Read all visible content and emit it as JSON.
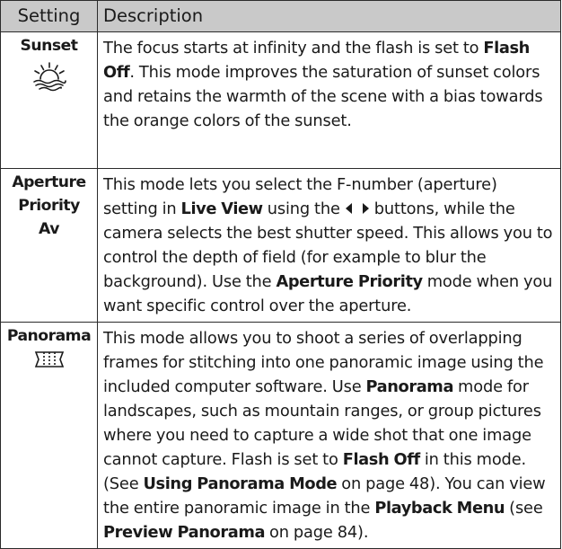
{
  "table": {
    "headers": {
      "setting": "Setting",
      "description": "Description"
    },
    "rows": {
      "sunset": {
        "name": "Sunset",
        "icon": "sunset-icon",
        "desc": {
          "t1": "The focus starts at infinity and the flash is set to ",
          "b1": "Flash Off",
          "t2": ". This mode improves the saturation of sunset colors and retains the warmth of the scene with a bias towards the orange colors of the sunset."
        }
      },
      "aperture": {
        "name_line1": "Aperture",
        "name_line2": "Priority",
        "name_line3": "Av",
        "desc": {
          "t1": "This mode lets you select the F-number (aperture) setting in ",
          "b1": "Live View",
          "t2": " using the",
          "arrows_icon": "left-right-arrows-icon",
          "t3": "buttons, while the camera selects the best shutter speed. This allows you to control the depth of field (for example to blur the background). Use the ",
          "b2": "Aperture Priority",
          "t4": " mode when you want specific control over the aperture."
        }
      },
      "panorama": {
        "name": "Panorama",
        "icon": "panorama-icon",
        "desc": {
          "t1": "This mode allows you to shoot a series of overlapping frames for stitching into one panoramic image using the included computer software. Use ",
          "b1": "Panorama",
          "t2": " mode for landscapes, such as mountain ranges, or group pictures where you need to capture a wide shot that one image cannot capture. Flash is set to ",
          "b2": "Flash Off",
          "t3": " in this mode. (See ",
          "b3": "Using Panorama Mode",
          "t4": " on page 48). You can view the entire panoramic image in the ",
          "b4": "Playback Menu",
          "t5": " (see ",
          "b5": "Preview Panorama",
          "t6": " on page 84)."
        }
      }
    }
  },
  "colors": {
    "header_bg": "#c9c9c9",
    "border": "#2b2b2b",
    "text": "#1a1a1a"
  }
}
